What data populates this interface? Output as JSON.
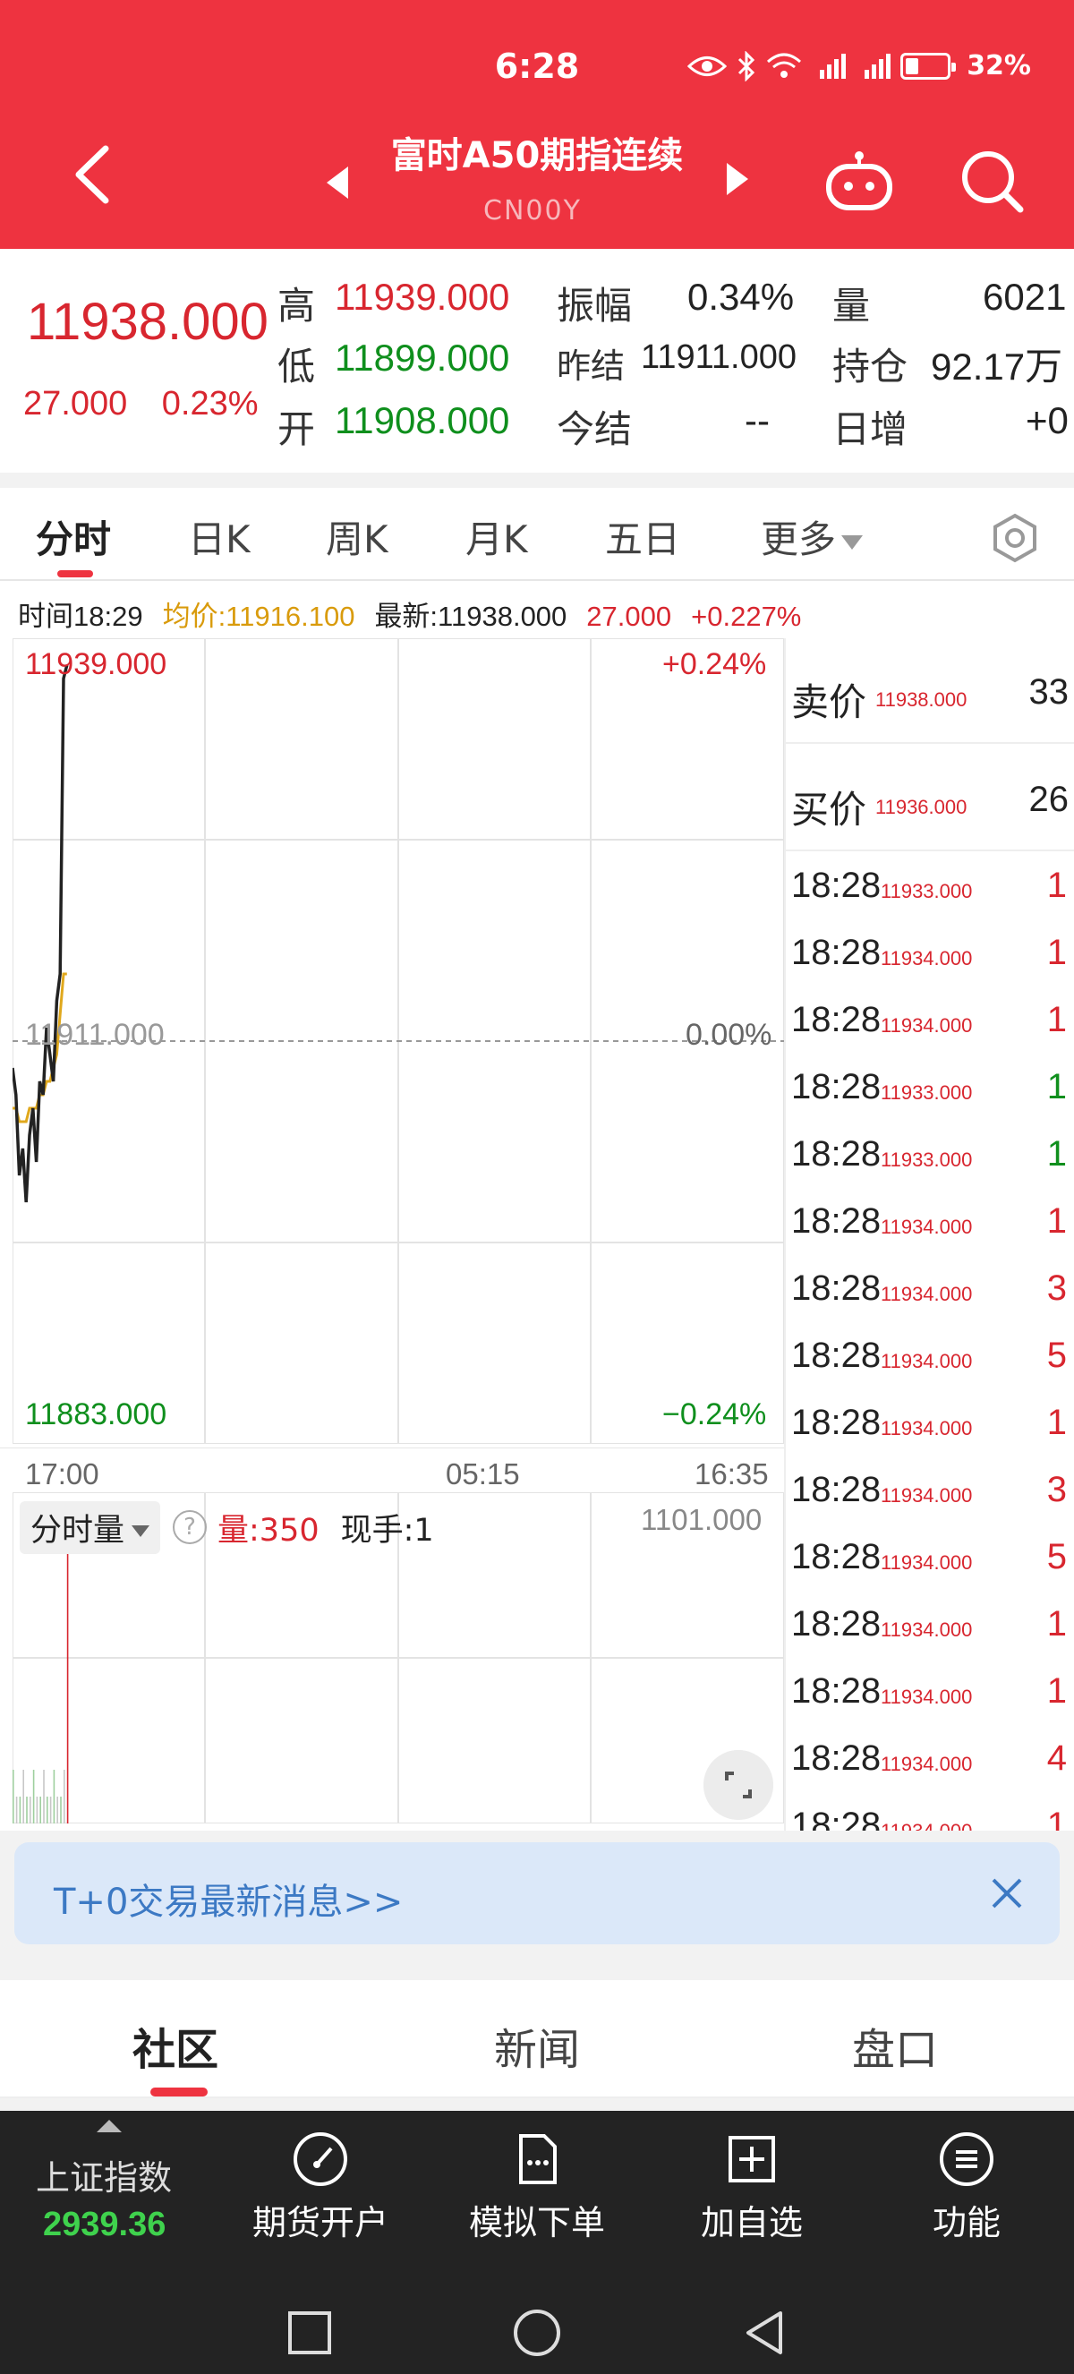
{
  "status_bar": {
    "time": "6:28",
    "network": "⁴ᴳ ²ᴳ",
    "battery": "32%"
  },
  "header": {
    "title": "富时A50期指连续",
    "subtitle": "CN00Y"
  },
  "quote": {
    "last_price": "11938.000",
    "change": "27.000",
    "change_pct": "0.23%",
    "high_label": "高",
    "high": "11939.000",
    "low_label": "低",
    "low": "11899.000",
    "open_label": "开",
    "open": "11908.000",
    "amplitude_label": "振幅",
    "amplitude": "0.34%",
    "prev_settle_label": "昨结",
    "prev_settle": "11911.000",
    "today_settle_label": "今结",
    "today_settle": "--",
    "volume_label": "量",
    "volume": "6021",
    "open_interest_label": "持仓",
    "open_interest": "92.17万",
    "daily_increase_label": "日增",
    "daily_increase": "+0"
  },
  "tabs": {
    "items": [
      "分时",
      "日K",
      "周K",
      "月K",
      "五日",
      "更多"
    ],
    "active": "分时"
  },
  "info_row": {
    "time": "时间18:29",
    "avg": "均价:11916.100",
    "latest": "最新:11938.000",
    "change": "27.000",
    "change_pct": "+0.227%"
  },
  "axes": {
    "top_price": "11939.000",
    "top_pct": "+0.24%",
    "mid_price": "11911.000",
    "mid_pct": "0.00%",
    "bottom_price": "11883.000",
    "bottom_pct": "−0.24%",
    "time_start": "17:00",
    "time_mid": "05:15",
    "time_end": "16:35"
  },
  "volume_panel": {
    "selector": "分时量",
    "volume": "量:350",
    "hand": "现手:1",
    "max": "1101.000"
  },
  "order_book": {
    "ask_label": "卖价",
    "ask_price": "11938.000",
    "ask_qty": "33",
    "bid_label": "买价",
    "bid_price": "11936.000",
    "bid_qty": "26"
  },
  "ticks": [
    {
      "time": "18:28",
      "price": "11933.000",
      "qty": "1",
      "dir": "up"
    },
    {
      "time": "18:28",
      "price": "11934.000",
      "qty": "1",
      "dir": "up"
    },
    {
      "time": "18:28",
      "price": "11934.000",
      "qty": "1",
      "dir": "up"
    },
    {
      "time": "18:28",
      "price": "11933.000",
      "qty": "1",
      "dir": "down"
    },
    {
      "time": "18:28",
      "price": "11933.000",
      "qty": "1",
      "dir": "down"
    },
    {
      "time": "18:28",
      "price": "11934.000",
      "qty": "1",
      "dir": "up"
    },
    {
      "time": "18:28",
      "price": "11934.000",
      "qty": "3",
      "dir": "up"
    },
    {
      "time": "18:28",
      "price": "11934.000",
      "qty": "5",
      "dir": "up"
    },
    {
      "time": "18:28",
      "price": "11934.000",
      "qty": "1",
      "dir": "up"
    },
    {
      "time": "18:28",
      "price": "11934.000",
      "qty": "3",
      "dir": "up"
    },
    {
      "time": "18:28",
      "price": "11934.000",
      "qty": "5",
      "dir": "up"
    },
    {
      "time": "18:28",
      "price": "11934.000",
      "qty": "1",
      "dir": "up"
    },
    {
      "time": "18:28",
      "price": "11934.000",
      "qty": "1",
      "dir": "up"
    },
    {
      "time": "18:28",
      "price": "11934.000",
      "qty": "4",
      "dir": "up"
    },
    {
      "time": "18:28",
      "price": "11934.000",
      "qty": "1",
      "dir": "up"
    }
  ],
  "banner": {
    "text": "T+0交易最新消息>>"
  },
  "sections": {
    "items": [
      "社区",
      "新闻",
      "盘口"
    ],
    "active": "社区"
  },
  "bottom_bar": {
    "index_name": "上证指数",
    "index_value": "2939.36",
    "items": [
      "期货开户",
      "模拟下单",
      "加自选",
      "功能"
    ]
  },
  "colors": {
    "brand_red": "#ee3340",
    "up_red": "#d8262f",
    "down_green": "#0f8f1d",
    "avg_line": "#e0a81c",
    "price_line": "#222222"
  },
  "chart_data": {
    "type": "line",
    "ylim": [
      11883.0,
      11939.0
    ],
    "reference": 11911.0,
    "series": [
      {
        "values": [
          11909,
          11907,
          11901,
          11903,
          11899,
          11904,
          11906,
          11902,
          11908,
          11907,
          11912,
          11910,
          11908,
          11914,
          11916,
          11938,
          11939
        ]
      },
      {
        "values": [
          11906,
          11906,
          11905,
          11905,
          11905,
          11906,
          11906,
          11906,
          11907,
          11907,
          11908,
          11908,
          11909,
          11910,
          11913,
          11916,
          11916
        ]
      }
    ],
    "volume": [
      0,
      0,
      0,
      0,
      0,
      0,
      0,
      0,
      0,
      0,
      0,
      0,
      0,
      0,
      0,
      0,
      1101
    ]
  }
}
